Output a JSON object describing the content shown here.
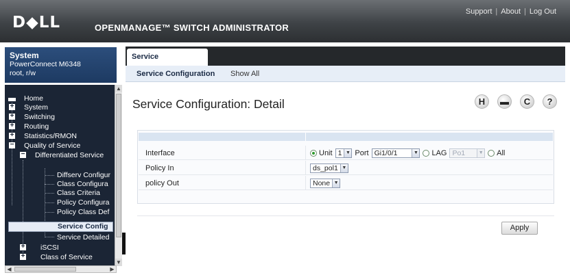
{
  "header": {
    "logo": "D◆LL",
    "app_title": "OPENMANAGE™ SWITCH ADMINISTRATOR",
    "links": [
      "Support",
      "About",
      "Log Out"
    ],
    "separator": "|"
  },
  "system": {
    "title": "System",
    "model": "PowerConnect M6348",
    "user": "root, r/w"
  },
  "tree": {
    "items": [
      {
        "label": "Home",
        "level": 0,
        "icon": "home-icon"
      },
      {
        "label": "System",
        "level": 0,
        "icon": "expand-plus-icon"
      },
      {
        "label": "Switching",
        "level": 0,
        "icon": "expand-plus-icon"
      },
      {
        "label": "Routing",
        "level": 0,
        "icon": "expand-plus-icon"
      },
      {
        "label": "Statistics/RMON",
        "level": 0,
        "icon": "expand-plus-icon"
      },
      {
        "label": "Quality of Service",
        "level": 0,
        "icon": "collapse-minus-icon"
      },
      {
        "label": "Differentiated Service",
        "level": 1,
        "icon": "collapse-minus-icon"
      },
      {
        "label": "Diffserv Configur",
        "level": 2
      },
      {
        "label": "Class Configura",
        "level": 2
      },
      {
        "label": "Class Criteria",
        "level": 2
      },
      {
        "label": "Policy Configura",
        "level": 2
      },
      {
        "label": "Policy Class Def",
        "level": 2
      },
      {
        "label": "Service Config",
        "level": 2,
        "selected": true
      },
      {
        "label": "Service Detailed",
        "level": 2
      },
      {
        "label": "iSCSI",
        "level": 1,
        "icon": "expand-plus-icon"
      },
      {
        "label": "Class of Service",
        "level": 1,
        "icon": "expand-plus-icon"
      }
    ]
  },
  "tabs": {
    "active": "Service Configuration",
    "subnav": [
      "Service Configuration",
      "Show All"
    ]
  },
  "page": {
    "title": "Service Configuration: Detail",
    "toolbar_icons": [
      "save-icon",
      "print-icon",
      "refresh-icon",
      "help-icon"
    ],
    "toolbar_glyphs": [
      "H",
      "▬",
      "C",
      "?"
    ]
  },
  "form": {
    "interface": {
      "label": "Interface",
      "unit_label": "Unit",
      "unit_value": "1",
      "port_label": "Port",
      "port_value": "Gi1/0/1",
      "lag_label": "LAG",
      "lag_value": "Po1",
      "all_label": "All",
      "selected": "Unit"
    },
    "policy_in": {
      "label": "Policy In",
      "value": "ds_pol1"
    },
    "policy_out": {
      "label": "policy Out",
      "value": "None"
    }
  },
  "actions": {
    "apply_label": "Apply"
  },
  "colors": {
    "header_dark": "#2c2f32",
    "nav_dark": "#1b2535",
    "system_blue": "#1d3a62",
    "subnav_light": "#e7eef7",
    "radio_green": "#2d9a2d"
  }
}
